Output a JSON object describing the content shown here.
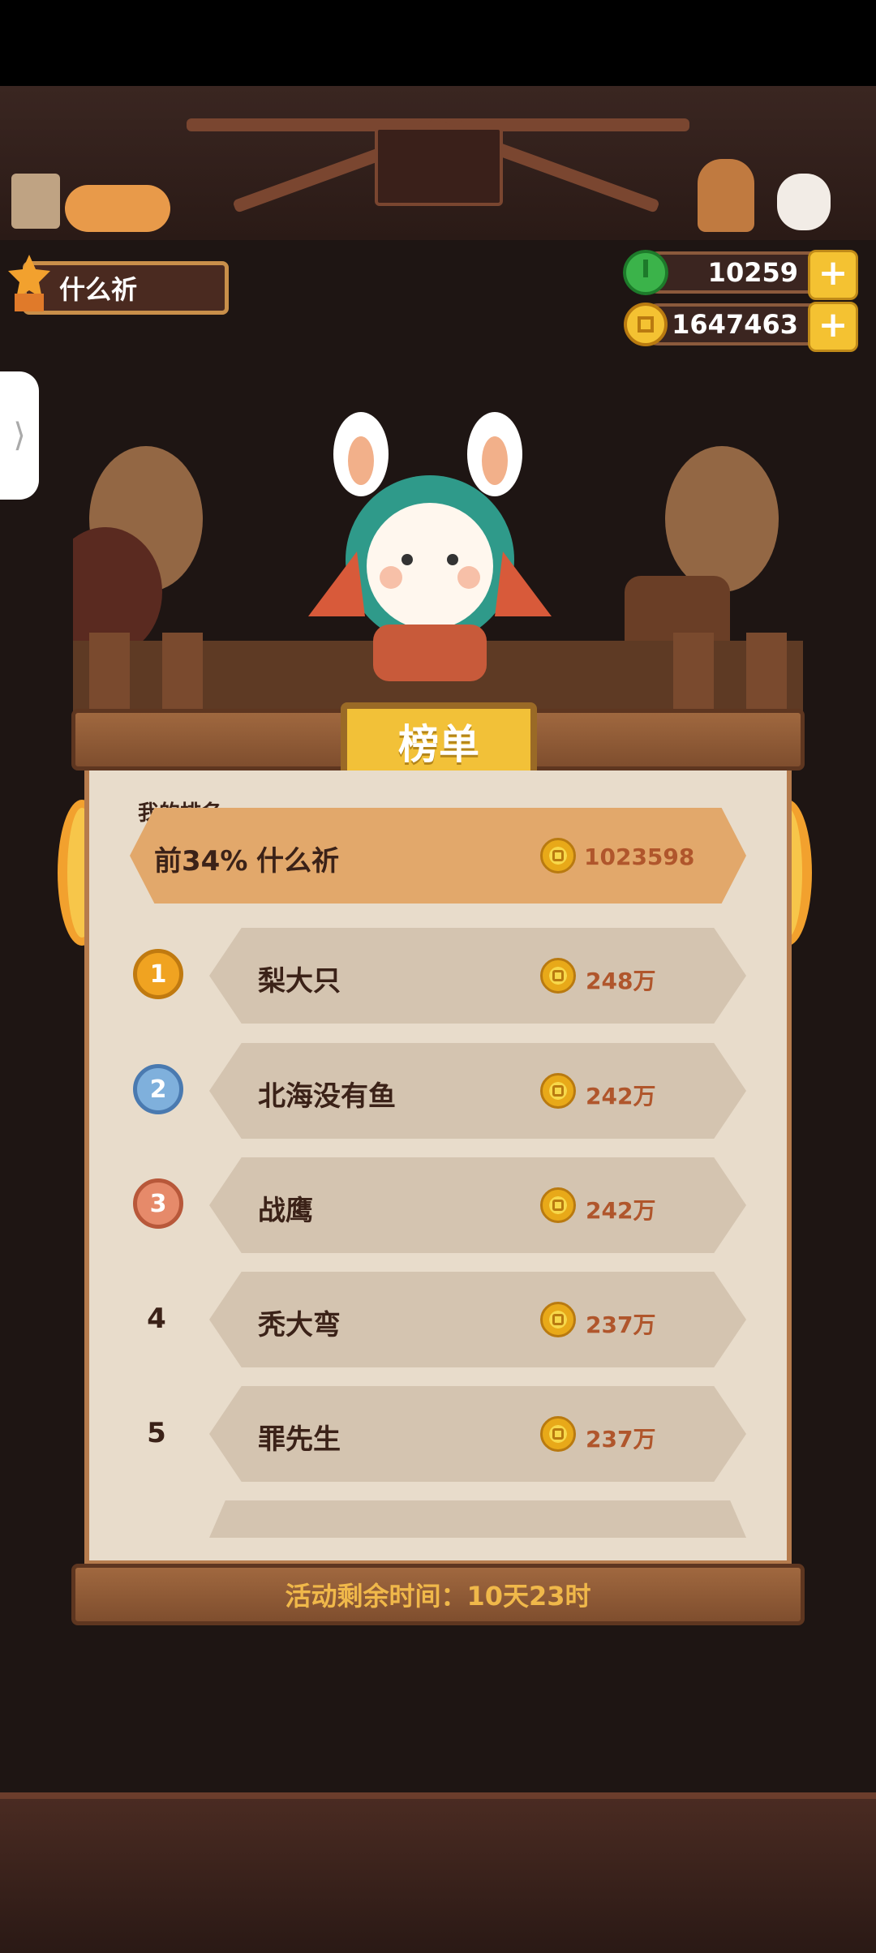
{
  "header": {
    "user_name": "什么祈",
    "gem_count": "10259",
    "coin_count": "1647463",
    "plus_label": "+"
  },
  "side_tab": {
    "arrow": "⟩"
  },
  "board": {
    "title": "榜单",
    "my_rank_label": "我的排名",
    "my_rank": {
      "percent": "前34%",
      "name": "什么祈",
      "score": "1023598"
    },
    "rows": [
      {
        "rank": "1",
        "name": "梨大只",
        "score": "248万"
      },
      {
        "rank": "2",
        "name": "北海没有鱼",
        "score": "242万"
      },
      {
        "rank": "3",
        "name": "战鹰",
        "score": "242万"
      },
      {
        "rank": "4",
        "name": "秃大弯",
        "score": "237万"
      },
      {
        "rank": "5",
        "name": "罪先生",
        "score": "237万"
      }
    ],
    "footer": "活动剩余时间：10天23时"
  },
  "colors": {
    "gold": "#f2c138",
    "my_row": "#e2a86b",
    "row": "#d4c4b0",
    "score": "#b0562c",
    "medal_gold": "#f0a321",
    "medal_silver": "#7fb0dc",
    "medal_bronze": "#e68a6a"
  },
  "icons": [
    "gem-icon",
    "coin-icon",
    "plus-icon",
    "chevron-right-icon",
    "medal-icon"
  ]
}
